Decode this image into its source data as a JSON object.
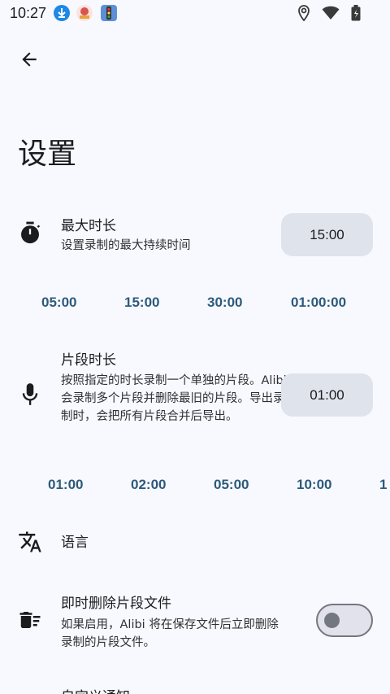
{
  "status": {
    "time": "10:27"
  },
  "page": {
    "title": "设置"
  },
  "settings": {
    "max_duration": {
      "title": "最大时长",
      "desc": "设置录制的最大持续时间",
      "value": "15:00",
      "presets": [
        "05:00",
        "15:00",
        "30:00",
        "01:00:00"
      ]
    },
    "segment_duration": {
      "title": "片段时长",
      "desc": "按照指定的时长录制一个单独的片段。Alibi 会录制多个片段并删除最旧的片段。导出录制时，会把所有片段合并后导出。",
      "value": "01:00",
      "presets": [
        "01:00",
        "02:00",
        "05:00",
        "10:00",
        "1"
      ]
    },
    "language": {
      "title": "语言"
    },
    "delete_segments": {
      "title": "即时删除片段文件",
      "desc": "如果启用，Alibi 将在保存文件后立即删除录制的片段文件。",
      "enabled": false
    },
    "custom_notification": {
      "title": "自定义通知"
    }
  },
  "icons": {
    "back": "arrow-left-icon",
    "timer": "stopwatch-icon",
    "mic": "microphone-icon",
    "language": "translate-icon",
    "delete": "delete-sweep-icon"
  }
}
